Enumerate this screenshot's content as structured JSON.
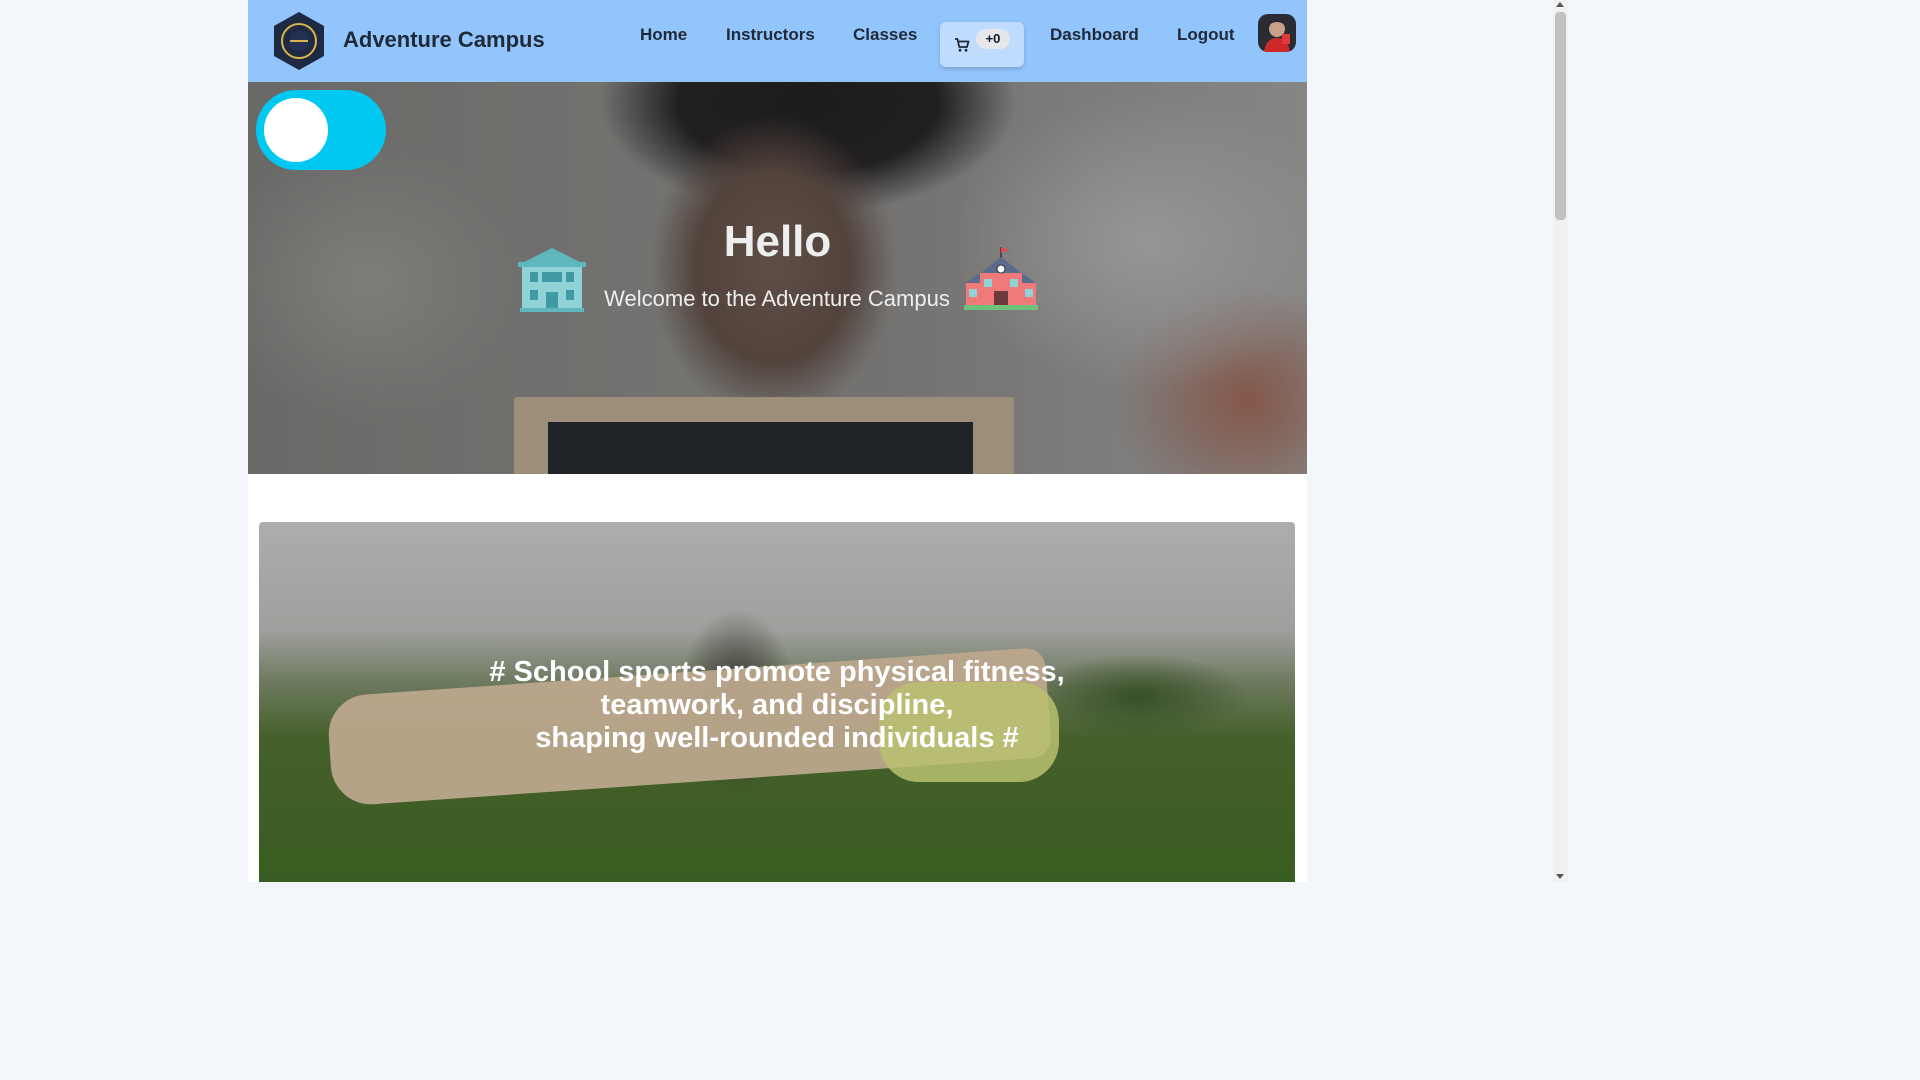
{
  "navbar": {
    "brand": "Adventure Campus",
    "links": [
      "Home",
      "Instructors",
      "Classes",
      "Dashboard",
      "Logout"
    ],
    "cart_count": "+0",
    "logo_icon": "campus-logo-icon",
    "cart_icon": "shopping-cart-icon",
    "avatar_icon": "user-avatar"
  },
  "hero": {
    "title": "Hello",
    "subtitle": "Welcome to the Adventure Campus",
    "left_icon": "school-building-icon",
    "right_icon": "schoolhouse-icon"
  },
  "banner": {
    "lines": [
      "# School sports promote physical fitness,",
      "teamwork, and discipline,",
      "shaping well-rounded individuals #"
    ]
  },
  "colors": {
    "navbar_bg": "#93c5fd",
    "toggle_bg": "#00c8f0",
    "page_bg": "#f3f6fb"
  }
}
